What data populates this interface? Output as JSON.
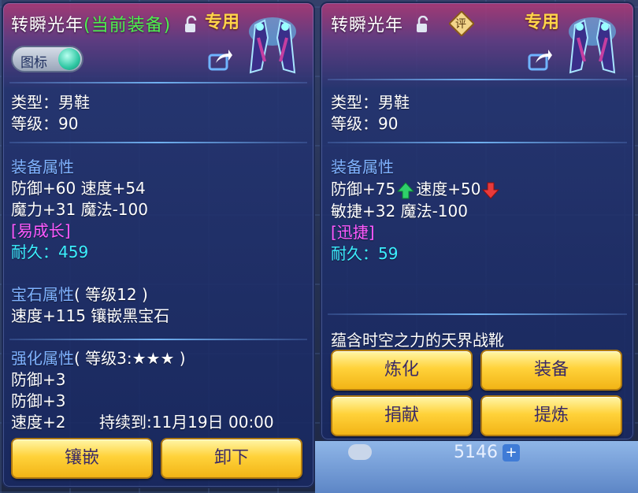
{
  "background": {
    "bottom_value": "5146",
    "plus_label": "+"
  },
  "left": {
    "title": "转瞬光年",
    "title_suffix": "(当前装备)",
    "exclusive": "专用",
    "logo_label": "图标",
    "type_line": "类型：男鞋",
    "level_line": "等级：90",
    "equip_attr_head": "装备属性",
    "attr_line1": "防御+60 速度+54",
    "attr_line2": "魔力+31 魔法-100",
    "special": "[易成长]",
    "durability": "耐久：459",
    "gem_head": "宝石属性",
    "gem_level": "( 等级12 )",
    "gem_line": "速度+115 镶嵌黑宝石",
    "enhance_head": "强化属性",
    "enhance_level": "( 等级3:★★★ )",
    "enhance_line1": "防御+3",
    "enhance_line2": "防御+3",
    "enhance_line3": "速度+2",
    "duration": "持续到:11月19日 00:00",
    "buttons": [
      "镶嵌",
      "卸下"
    ]
  },
  "right": {
    "title": "转瞬光年",
    "appraise_label": "评",
    "exclusive": "专用",
    "type_line": "类型：男鞋",
    "level_line": "等级：90",
    "equip_attr_head": "装备属性",
    "defense": "防御+75",
    "speed": "速度+50",
    "attr_line2": "敏捷+32 魔法-100",
    "special": "[迅捷]",
    "durability": "耐久：59",
    "description": "蕴含时空之力的天界战靴",
    "buttons": [
      "炼化",
      "装备",
      "捐献",
      "提炼"
    ]
  },
  "icons": {
    "lock": "lock-open-icon",
    "share": "share-icon",
    "item": "boots-item-icon",
    "up": "arrow-up-icon",
    "down": "arrow-down-icon"
  },
  "colors": {
    "heading": "#7fb2ff",
    "current_equip": "#4ef04e",
    "special": "#ff5aff",
    "durability": "#3cf0ff",
    "exclusive": "#ffd54a",
    "up_arrow": "#2fd06a",
    "down_arrow": "#e83a3a"
  }
}
